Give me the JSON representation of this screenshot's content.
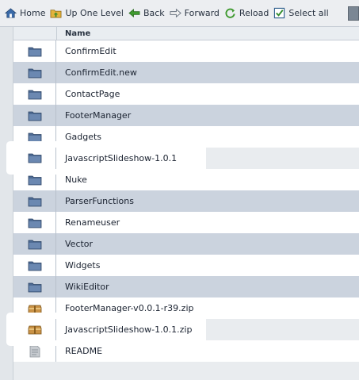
{
  "toolbar": {
    "home": "Home",
    "up": "Up One Level",
    "back": "Back",
    "forward": "Forward",
    "reload": "Reload",
    "select_all": "Select all"
  },
  "table": {
    "col_name": "Name",
    "rows": [
      {
        "name": "ConfirmEdit",
        "type": "folder"
      },
      {
        "name": "ConfirmEdit.new",
        "type": "folder"
      },
      {
        "name": "ContactPage",
        "type": "folder"
      },
      {
        "name": "FooterManager",
        "type": "folder"
      },
      {
        "name": "Gadgets",
        "type": "folder"
      },
      {
        "name": "JavascriptSlideshow-1.0.1",
        "type": "folder",
        "highlighted": true
      },
      {
        "name": "Nuke",
        "type": "folder"
      },
      {
        "name": "ParserFunctions",
        "type": "folder"
      },
      {
        "name": "Renameuser",
        "type": "folder"
      },
      {
        "name": "Vector",
        "type": "folder"
      },
      {
        "name": "Widgets",
        "type": "folder"
      },
      {
        "name": "WikiEditor",
        "type": "folder"
      },
      {
        "name": "FooterManager-v0.0.1-r39.zip",
        "type": "zip"
      },
      {
        "name": "JavascriptSlideshow-1.0.1.zip",
        "type": "zip",
        "highlighted": true
      },
      {
        "name": "README",
        "type": "file"
      }
    ]
  },
  "colors": {
    "row_alt": "#cbd3de",
    "folder": "#4d6a93",
    "zip": "#b07a32"
  }
}
